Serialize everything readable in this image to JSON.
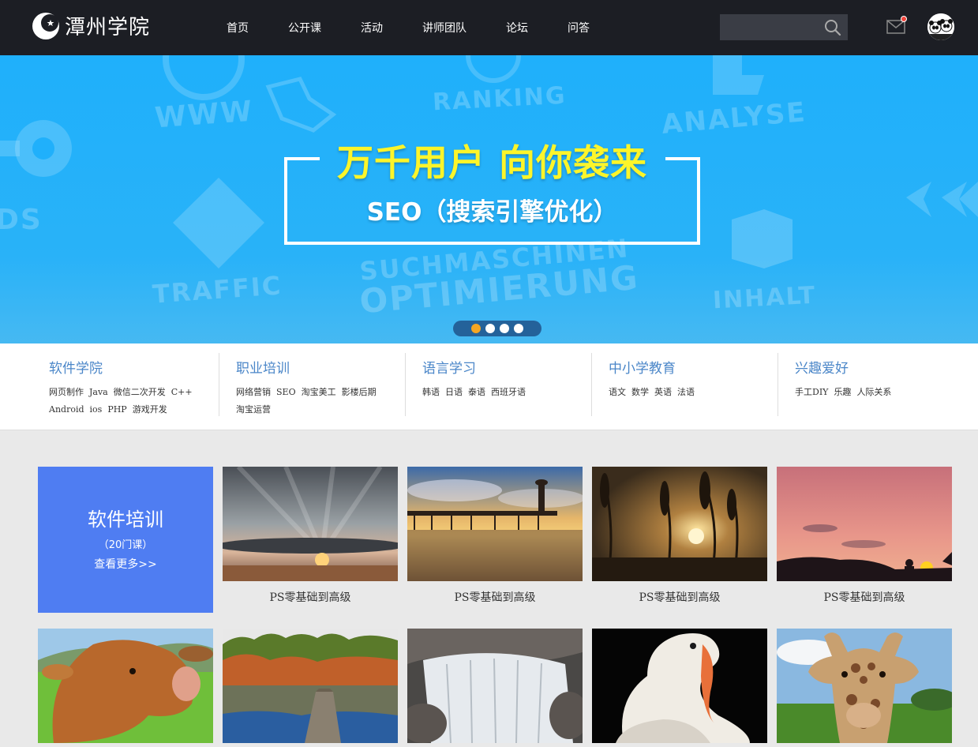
{
  "header": {
    "logo_text": "潭州学院",
    "nav": [
      "首页",
      "公开课",
      "活动",
      "讲师团队",
      "论坛",
      "问答"
    ],
    "search_placeholder": ""
  },
  "banner": {
    "headline": "万千用户 向你袭来",
    "subtitle": "SEO（搜索引擎优化）",
    "bg_words": [
      "WWW",
      "RANKING",
      "ANALYSE",
      "TRAFFIC",
      "SUCHMASCHINEN",
      "OPTIMIERUNG",
      "INHALT",
      "DS"
    ],
    "slides_total": 4,
    "active_slide": 1
  },
  "categories": [
    {
      "title": "软件学院",
      "links": [
        "网页制作",
        "Java",
        "微信二次开发",
        "C++",
        "Android",
        "ios",
        "PHP",
        "游戏开发"
      ]
    },
    {
      "title": "职业培训",
      "links": [
        "网络营销",
        "SEO",
        "淘宝美工",
        "影楼后期",
        "淘宝运营"
      ]
    },
    {
      "title": "语言学习",
      "links": [
        "韩语",
        "日语",
        "泰语",
        "西班牙语"
      ]
    },
    {
      "title": "中小学教育",
      "links": [
        "语文",
        "数学",
        "英语",
        "法语"
      ]
    },
    {
      "title": "兴趣爱好",
      "links": [
        "手工DIY",
        "乐趣",
        "人际关系"
      ]
    }
  ],
  "feature": {
    "title": "软件培训",
    "count": "（20门课）",
    "more": "查看更多>>"
  },
  "courses_row1": [
    {
      "caption": "PS零基础到高级",
      "image": "sunset-clouds"
    },
    {
      "caption": "PS零基础到高级",
      "image": "pier-sunset"
    },
    {
      "caption": "PS零基础到高级",
      "image": "grass-sunset"
    },
    {
      "caption": "PS零基础到高级",
      "image": "dusk-silhouette"
    }
  ],
  "courses_row2": [
    {
      "image": "cow"
    },
    {
      "image": "lake-forest"
    },
    {
      "image": "waterfall"
    },
    {
      "image": "pelican"
    },
    {
      "image": "giraffe"
    }
  ],
  "colors": {
    "header_bg": "#1c1e24",
    "banner_bg": "#29b2f8",
    "headline": "#fcf52a",
    "category_title": "#4a86c8",
    "feature_bg": "#4f7df2",
    "active_dot": "#f5a623"
  }
}
